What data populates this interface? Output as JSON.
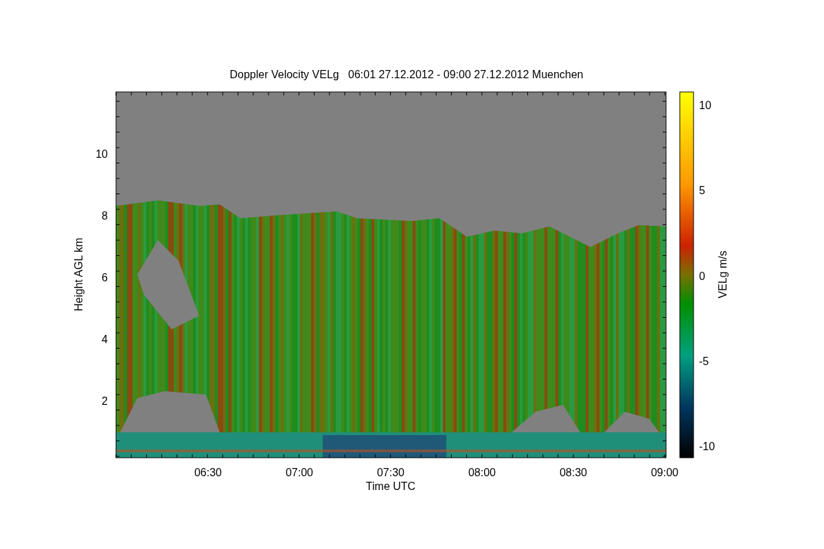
{
  "title": "Doppler Velocity VELg   06:01 27.12.2012 - 09:00 27.12.2012 Muenchen",
  "x_axis": {
    "label": "Time UTC",
    "ticks": [
      "06:30",
      "07:00",
      "07:30",
      "08:00",
      "08:30",
      "09:00"
    ]
  },
  "y_axis": {
    "label": "Height AGL km",
    "ticks": [
      "10",
      "8",
      "6",
      "4",
      "2"
    ]
  },
  "colorbar": {
    "label": "VELg m/s",
    "ticks": [
      "10",
      "5",
      "0",
      "-5",
      "-10"
    ]
  }
}
